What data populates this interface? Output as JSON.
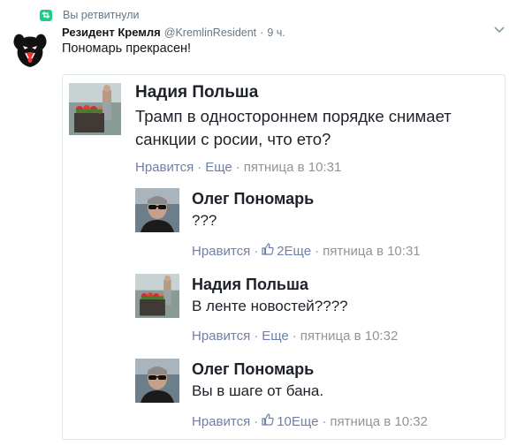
{
  "retweet": {
    "label": "Вы ретвитнули"
  },
  "tweet": {
    "author_name": "Резидент Кремля",
    "author_handle": "@KremlinResident",
    "time": "9 ч.",
    "separator": "·",
    "text": "Пономарь прекрасен!"
  },
  "embedded": {
    "comments": [
      {
        "name": "Надия Польша",
        "text_lines": [
          "Трамп в одностороннем порядке снимает",
          "санкции с росии, что ето?"
        ],
        "like_label": "Нравится",
        "reply_label": "Еще",
        "likes": "",
        "timestamp": "пятница в 10:31"
      },
      {
        "name": "Олег Пономарь",
        "text_lines": [
          "???"
        ],
        "like_label": "Нравится",
        "reply_label": "Еще",
        "likes": "2",
        "timestamp": "пятница в 10:31"
      },
      {
        "name": "Надия Польша",
        "text_lines": [
          "В ленте новостей????"
        ],
        "like_label": "Нравится",
        "reply_label": "Еще",
        "likes": "",
        "timestamp": "пятница в 10:32"
      },
      {
        "name": "Олег Пономарь",
        "text_lines": [
          "Вы в шаге от бана."
        ],
        "like_label": "Нравится",
        "reply_label": "Еще",
        "likes": "10",
        "timestamp": "пятница в 10:32"
      }
    ]
  },
  "colors": {
    "retweet_green": "#19cf86",
    "fb_link": "#6f7fa8",
    "meta_gray": "#90949c",
    "twitter_gray": "#657786"
  },
  "icons": {
    "retweet": "retweet-icon",
    "caret": "chevron-down-icon",
    "like": "thumbs-up-icon"
  }
}
